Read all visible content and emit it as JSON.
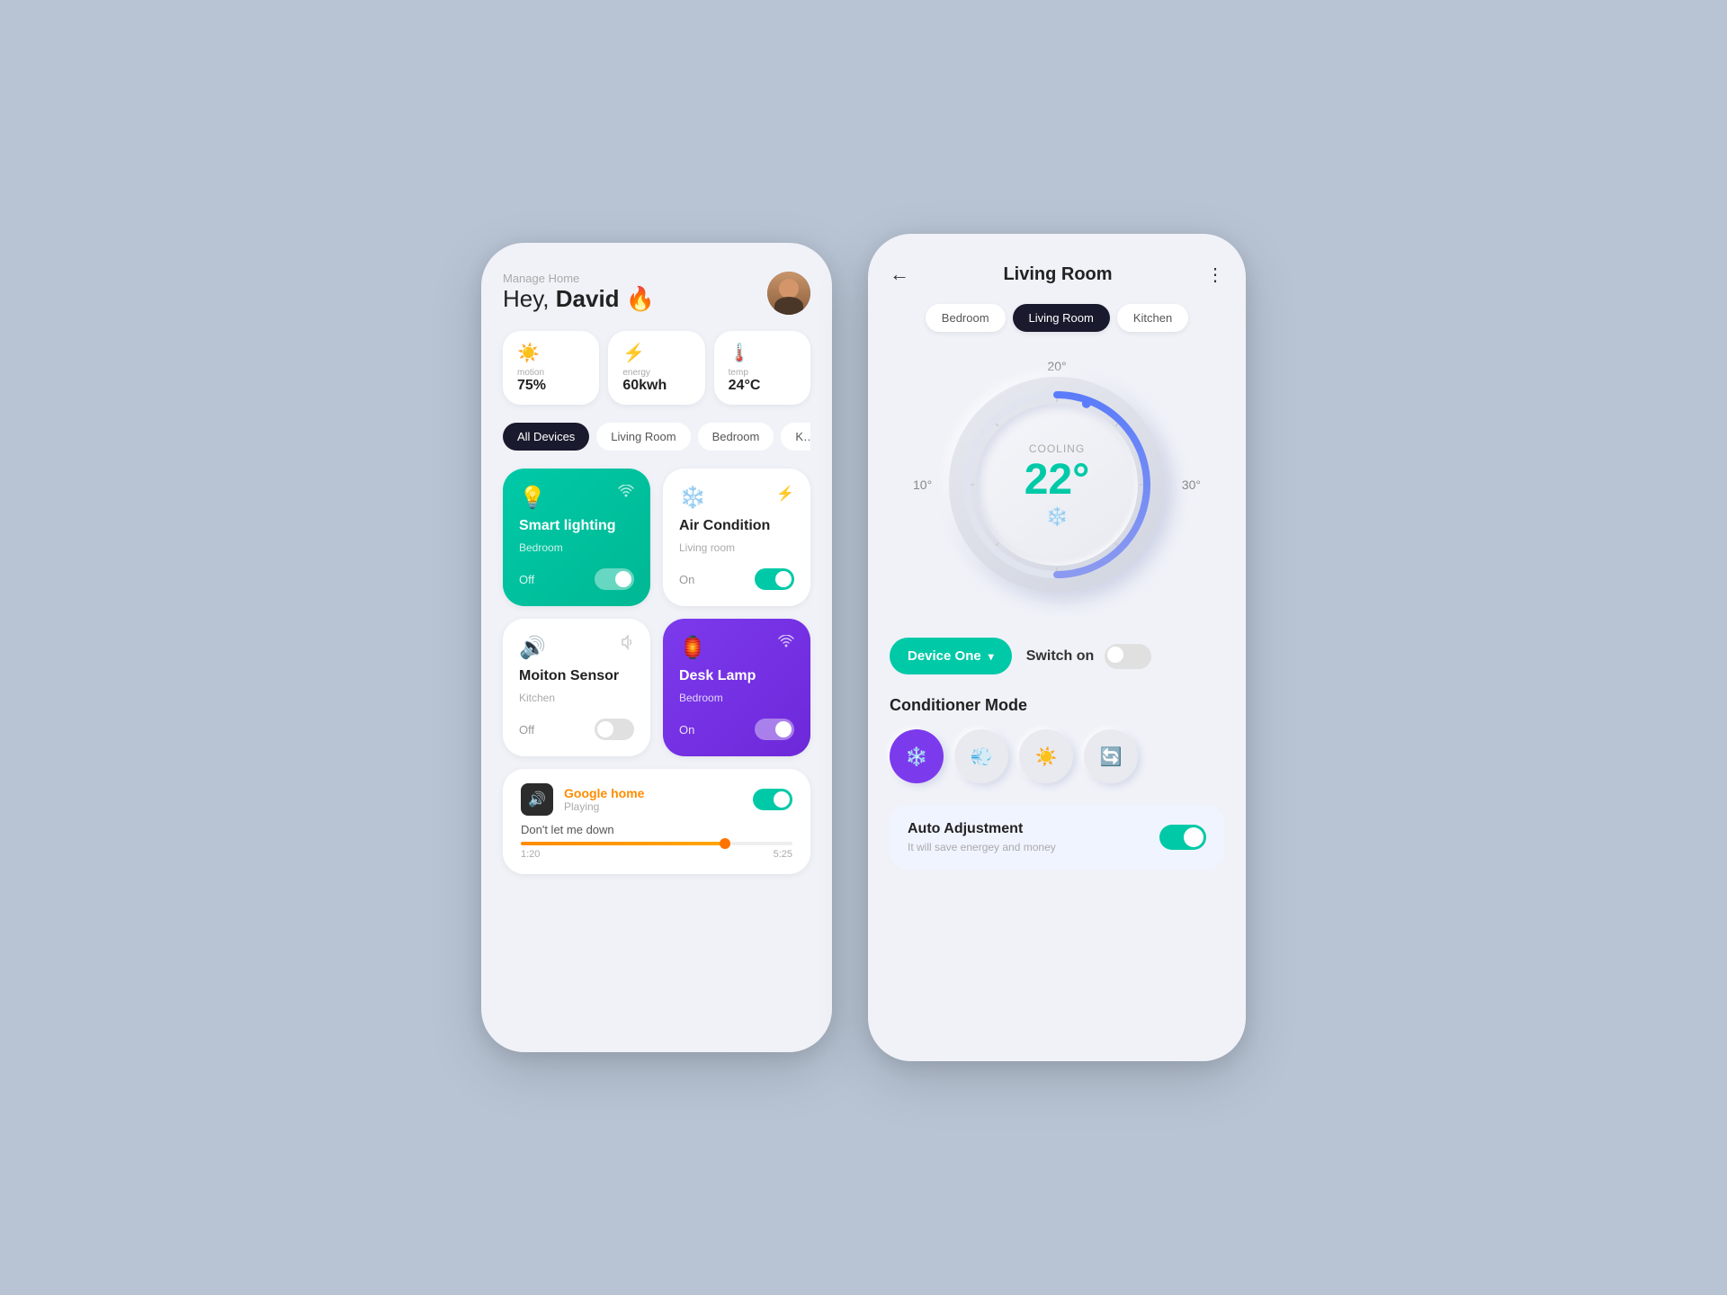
{
  "page": {
    "background": "#b8c4d4"
  },
  "phone1": {
    "header": {
      "manage_label": "Manage Home",
      "greeting_prefix": "Hey, ",
      "greeting_name": "David",
      "greeting_emoji": "🔥"
    },
    "stats": [
      {
        "icon": "☀️",
        "label": "motion",
        "value": "75%"
      },
      {
        "icon": "⚡",
        "label": "energy",
        "value": "60kwh"
      },
      {
        "icon": "🌡️",
        "label": "temp",
        "value": "24°C"
      }
    ],
    "filter_tabs": [
      {
        "label": "All Devices",
        "active": true
      },
      {
        "label": "Living Room",
        "active": false
      },
      {
        "label": "Bedroom",
        "active": false
      },
      {
        "label": "K…",
        "active": false
      }
    ],
    "devices": [
      {
        "name": "Smart lighting",
        "room": "Bedroom",
        "status": "Off",
        "toggle": "off",
        "theme": "teal",
        "icon": "💡",
        "conn_icon": "wifi"
      },
      {
        "name": "Air Condition",
        "room": "Living room",
        "status": "On",
        "toggle": "on",
        "theme": "white",
        "icon": "❄️",
        "conn_icon": "bt"
      },
      {
        "name": "Moiton Sensor",
        "room": "Kitchen",
        "status": "Off",
        "toggle": "off",
        "theme": "white",
        "icon": "🔊",
        "conn_icon": "bt"
      },
      {
        "name": "Desk Lamp",
        "room": "Bedroom",
        "status": "On",
        "toggle": "on",
        "theme": "purple",
        "icon": "🏮",
        "conn_icon": "wifi"
      }
    ],
    "google_home": {
      "name_prefix": "Google",
      "name_suffix": " home",
      "status": "Playing",
      "song": "Don't let me down",
      "time_current": "1:20",
      "time_total": "5:25"
    }
  },
  "phone2": {
    "back_label": "←",
    "title": "Living Room",
    "more_label": "⋮",
    "room_tabs": [
      {
        "label": "Bedroom",
        "active": false
      },
      {
        "label": "Living Room",
        "active": true
      },
      {
        "label": "Kitchen",
        "active": false
      }
    ],
    "thermostat": {
      "temp_top": "20°",
      "temp_left": "10°",
      "temp_right": "30°",
      "mode": "COOLING",
      "temperature": "22°",
      "icon": "❄️"
    },
    "device_selector": {
      "label": "Device One",
      "chevron": "▾"
    },
    "switch_on": {
      "label": "Switch on",
      "toggle_state": "off"
    },
    "conditioner_mode": {
      "title": "Conditioner Mode",
      "modes": [
        {
          "icon": "❄️",
          "active": true
        },
        {
          "icon": "💨",
          "active": false
        },
        {
          "icon": "☀️",
          "active": false
        },
        {
          "icon": "🔄",
          "active": false
        }
      ]
    },
    "auto_adjustment": {
      "title": "Auto Adjustment",
      "description": "It will save energey and money",
      "toggle_state": "on"
    }
  }
}
